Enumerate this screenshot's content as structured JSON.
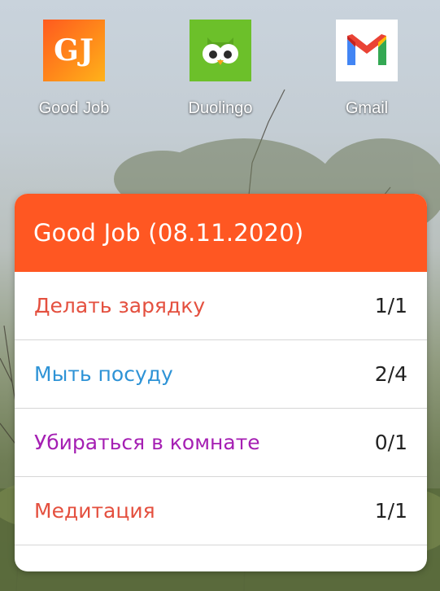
{
  "home": {
    "apps": [
      {
        "label": "Good Job",
        "icon": "good-job-icon",
        "glyph": "GJ"
      },
      {
        "label": "Duolingo",
        "icon": "duolingo-owl-icon"
      },
      {
        "label": "Gmail",
        "icon": "gmail-icon"
      }
    ]
  },
  "widget": {
    "title": "Good Job (08.11.2020)",
    "header_color": "#ff5722",
    "tasks": [
      {
        "name": "Делать зарядку",
        "count": "1/1",
        "color": "#e4503f"
      },
      {
        "name": "Мыть посуду",
        "count": "2/4",
        "color": "#2e93d6"
      },
      {
        "name": "Убираться в комнате",
        "count": "0/1",
        "color": "#a51fb3"
      },
      {
        "name": "Медитация",
        "count": "1/1",
        "color": "#e4503f"
      }
    ]
  }
}
